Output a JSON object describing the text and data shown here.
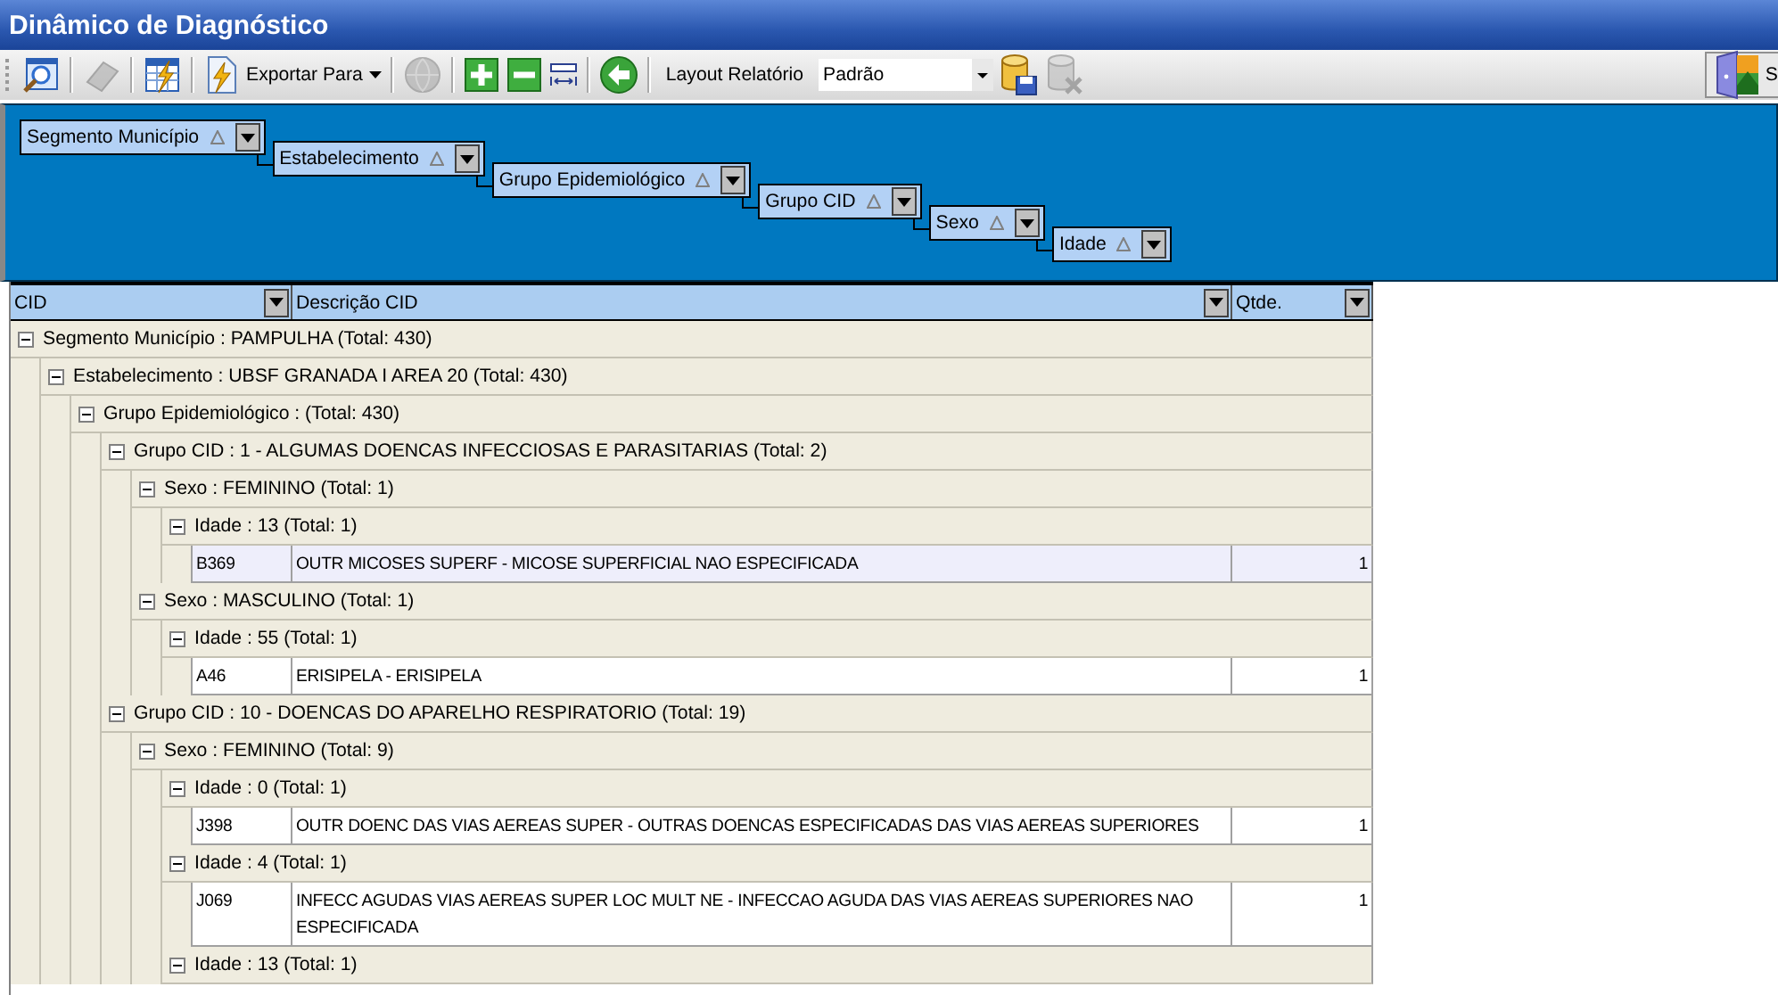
{
  "window": {
    "title": "Dinâmico de Diagnóstico"
  },
  "toolbar": {
    "items": [
      {
        "kind": "icon",
        "disabled": false
      },
      {
        "kind": "icon",
        "disabled": true
      },
      {
        "kind": "icon",
        "disabled": false
      },
      {
        "kind": "menu",
        "label": "Exportar Para",
        "disabled": false
      },
      {
        "kind": "icon",
        "disabled": true
      },
      {
        "kind": "icon",
        "disabled": false
      },
      {
        "kind": "icon",
        "disabled": false
      },
      {
        "kind": "icon",
        "disabled": false
      },
      {
        "kind": "icon",
        "disabled": false
      },
      {
        "kind": "select",
        "label": "Layout Relatório",
        "value": "Padrão"
      },
      {
        "kind": "icon",
        "disabled": false
      },
      {
        "kind": "icon",
        "disabled": true
      }
    ],
    "right_button": {
      "label": "S"
    }
  },
  "grouping": [
    {
      "label": "Segmento Município"
    },
    {
      "label": "Estabelecimento"
    },
    {
      "label": "Grupo Epidemiológico"
    },
    {
      "label": "Grupo CID"
    },
    {
      "label": "Sexo"
    },
    {
      "label": "Idade"
    }
  ],
  "table": {
    "columns": [
      {
        "label": "CID"
      },
      {
        "label": "Descrição CID"
      },
      {
        "label": "Qtde."
      }
    ],
    "rows": [
      {
        "kind": "group",
        "label": "Segmento Município : PAMPULHA (Total: 430)",
        "expanded": true,
        "children": [
          {
            "kind": "group",
            "label": "Estabelecimento : UBSF GRANADA I AREA 20 (Total: 430)",
            "expanded": true,
            "children": [
              {
                "kind": "group",
                "label": "Grupo Epidemiológico :  (Total: 430)",
                "expanded": true,
                "children": [
                  {
                    "kind": "group",
                    "label": "Grupo CID : 1 - ALGUMAS DOENCAS INFECCIOSAS E PARASITARIAS (Total: 2)",
                    "expanded": true,
                    "children": [
                      {
                        "kind": "group",
                        "label": "Sexo : FEMININO (Total: 1)",
                        "expanded": true,
                        "children": [
                          {
                            "kind": "group",
                            "label": "Idade : 13 (Total: 1)",
                            "expanded": true,
                            "children": [
                              {
                                "kind": "data",
                                "cid": "B369",
                                "description": "OUTR MICOSES SUPERF - MICOSE SUPERFICIAL NAO ESPECIFICADA",
                                "qtde": "1",
                                "selected": true
                              }
                            ]
                          }
                        ]
                      },
                      {
                        "kind": "group",
                        "label": "Sexo : MASCULINO (Total: 1)",
                        "expanded": true,
                        "children": [
                          {
                            "kind": "group",
                            "label": "Idade : 55 (Total: 1)",
                            "expanded": true,
                            "children": [
                              {
                                "kind": "data",
                                "cid": "A46",
                                "description": "ERISIPELA - ERISIPELA",
                                "qtde": "1",
                                "selected": false
                              }
                            ]
                          }
                        ]
                      }
                    ]
                  },
                  {
                    "kind": "group",
                    "label": "Grupo CID : 10 - DOENCAS DO APARELHO RESPIRATORIO (Total: 19)",
                    "expanded": true,
                    "children": [
                      {
                        "kind": "group",
                        "label": "Sexo : FEMININO (Total: 9)",
                        "expanded": true,
                        "children": [
                          {
                            "kind": "group",
                            "label": "Idade : 0 (Total: 1)",
                            "expanded": true,
                            "children": [
                              {
                                "kind": "data",
                                "cid": "J398",
                                "description": "OUTR DOENC DAS VIAS AEREAS SUPER - OUTRAS DOENCAS ESPECIFICADAS DAS VIAS AEREAS SUPERIORES",
                                "qtde": "1",
                                "selected": false
                              }
                            ]
                          },
                          {
                            "kind": "group",
                            "label": "Idade : 4 (Total: 1)",
                            "expanded": true,
                            "children": [
                              {
                                "kind": "data",
                                "cid": "J069",
                                "description": "INFECC AGUDAS VIAS AEREAS SUPER LOC MULT NE - INFECCAO AGUDA DAS VIAS AEREAS SUPERIORES NAO ESPECIFICADA",
                                "qtde": "1",
                                "selected": false
                              }
                            ]
                          },
                          {
                            "kind": "group",
                            "label": "Idade : 13 (Total: 1)",
                            "expanded": true
                          }
                        ]
                      }
                    ]
                  }
                ]
              }
            ]
          }
        ]
      }
    ]
  }
}
